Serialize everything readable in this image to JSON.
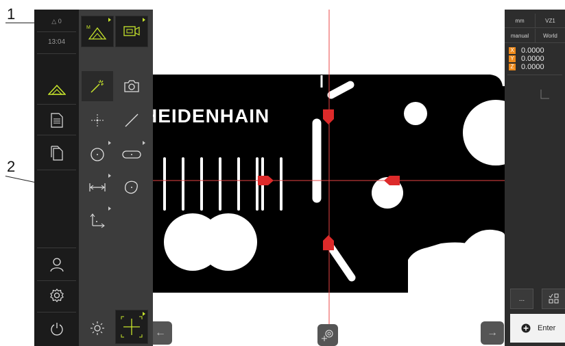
{
  "callouts": [
    {
      "label": "1"
    },
    {
      "label": "2"
    }
  ],
  "status": {
    "warning_count": "0",
    "time": "13:04"
  },
  "view": {
    "logo_text": "HEIDENHAIN",
    "crosshair_color": "#e84545",
    "marker_color": "#dd2a2a"
  },
  "right_panel": {
    "unit": "mm",
    "zero_point": "VZ1",
    "mode": "manual",
    "coord_system": "World",
    "axes": [
      {
        "axis": "X",
        "value": "0.0000"
      },
      {
        "axis": "Y",
        "value": "0.0000"
      },
      {
        "axis": "Z",
        "value": "0.0000"
      }
    ],
    "more_label": "...",
    "enter_label": "Enter"
  },
  "colors": {
    "accent_green": "#c8e62c",
    "axis_orange": "#ee8a1b"
  },
  "icons": {
    "status": "triangle-warning-icon",
    "main_menu": [
      "measure-icon",
      "protocol-icon",
      "file-management-icon",
      "user-icon",
      "settings-icon",
      "power-icon"
    ],
    "sensors": [
      "measure-manual-icon",
      "video-camera-icon"
    ],
    "tools": [
      "auto-measure-wand-icon",
      "camera-icon",
      "point-icon",
      "line-icon",
      "circle-icon",
      "slot-icon",
      "distance-icon",
      "blob-icon",
      "coordinate-system-icon"
    ],
    "bottom": [
      "brightness-icon",
      "crosshair-icon"
    ]
  }
}
